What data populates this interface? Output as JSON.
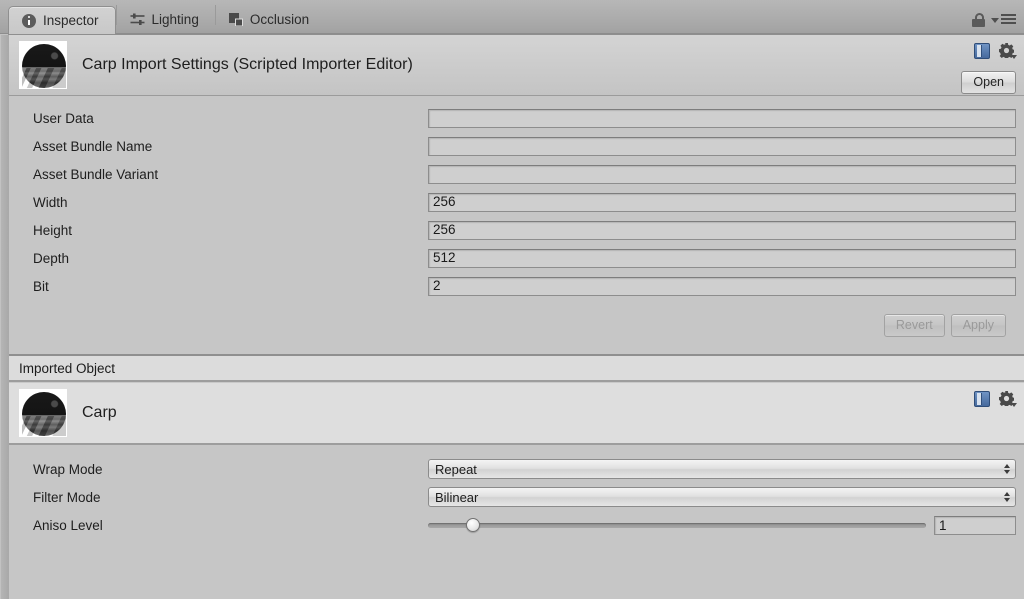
{
  "window": {
    "tabs": [
      {
        "label": "Inspector",
        "icon": "info-icon",
        "active": true
      },
      {
        "label": "Lighting",
        "icon": "sliders-icon",
        "active": false
      },
      {
        "label": "Occlusion",
        "icon": "layers-icon",
        "active": false
      }
    ],
    "lock_icon": "lock-icon",
    "menu_icon": "hamburger-menu-icon"
  },
  "importer": {
    "title": "Carp Import Settings (Scripted Importer Editor)",
    "thumbnail": "texture-preview-thumbnail",
    "help_icon": "help-book-icon",
    "gear_icon": "gear-icon",
    "open_label": "Open",
    "properties": [
      {
        "label": "User Data",
        "value": ""
      },
      {
        "label": "Asset Bundle Name",
        "value": ""
      },
      {
        "label": "Asset Bundle Variant",
        "value": ""
      },
      {
        "label": "Width",
        "value": "256"
      },
      {
        "label": "Height",
        "value": "256"
      },
      {
        "label": "Depth",
        "value": "512"
      },
      {
        "label": "Bit",
        "value": "2"
      }
    ],
    "revert_label": "Revert",
    "apply_label": "Apply"
  },
  "imported": {
    "section_label": "Imported Object",
    "title": "Carp",
    "thumbnail": "texture-preview-thumbnail",
    "help_icon": "help-book-icon",
    "gear_icon": "gear-icon",
    "wrap_mode": {
      "label": "Wrap Mode",
      "value": "Repeat"
    },
    "filter_mode": {
      "label": "Filter Mode",
      "value": "Bilinear"
    },
    "aniso_level": {
      "label": "Aniso Level",
      "value": "1",
      "slider_percent": 9
    }
  },
  "colors": {
    "panel_bg": "#c6c6c6",
    "header_bg": "#d0d0d0",
    "imported_bg": "#dedede",
    "field_bg": "#cfcfcf",
    "border": "#8d8d8d"
  }
}
